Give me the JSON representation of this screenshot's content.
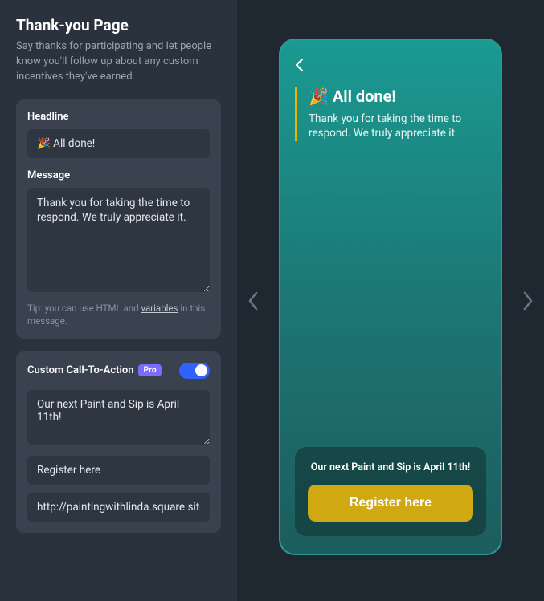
{
  "page": {
    "title": "Thank-you Page",
    "description": "Say thanks for participating and let people know you'll follow up about any custom incentives they've earned."
  },
  "headline": {
    "label": "Headline",
    "value": "🎉 All done!"
  },
  "message": {
    "label": "Message",
    "value": "Thank you for taking the time to respond. We truly appreciate it.",
    "tip_prefix": "Tip: you can use HTML and ",
    "tip_link": "variables",
    "tip_suffix": " in this message."
  },
  "cta": {
    "title": "Custom Call-To-Action",
    "badge": "Pro",
    "enabled": true,
    "text": "Our next Paint and Sip is April 11th!",
    "button_label": "Register here",
    "url": "http://paintingwithlinda.square.site"
  },
  "preview": {
    "headline": "🎉 All done!",
    "message": "Thank you for taking the time to respond. We truly appreciate it.",
    "cta_text": "Our next Paint and Sip is April 11th!",
    "cta_button": "Register here"
  }
}
